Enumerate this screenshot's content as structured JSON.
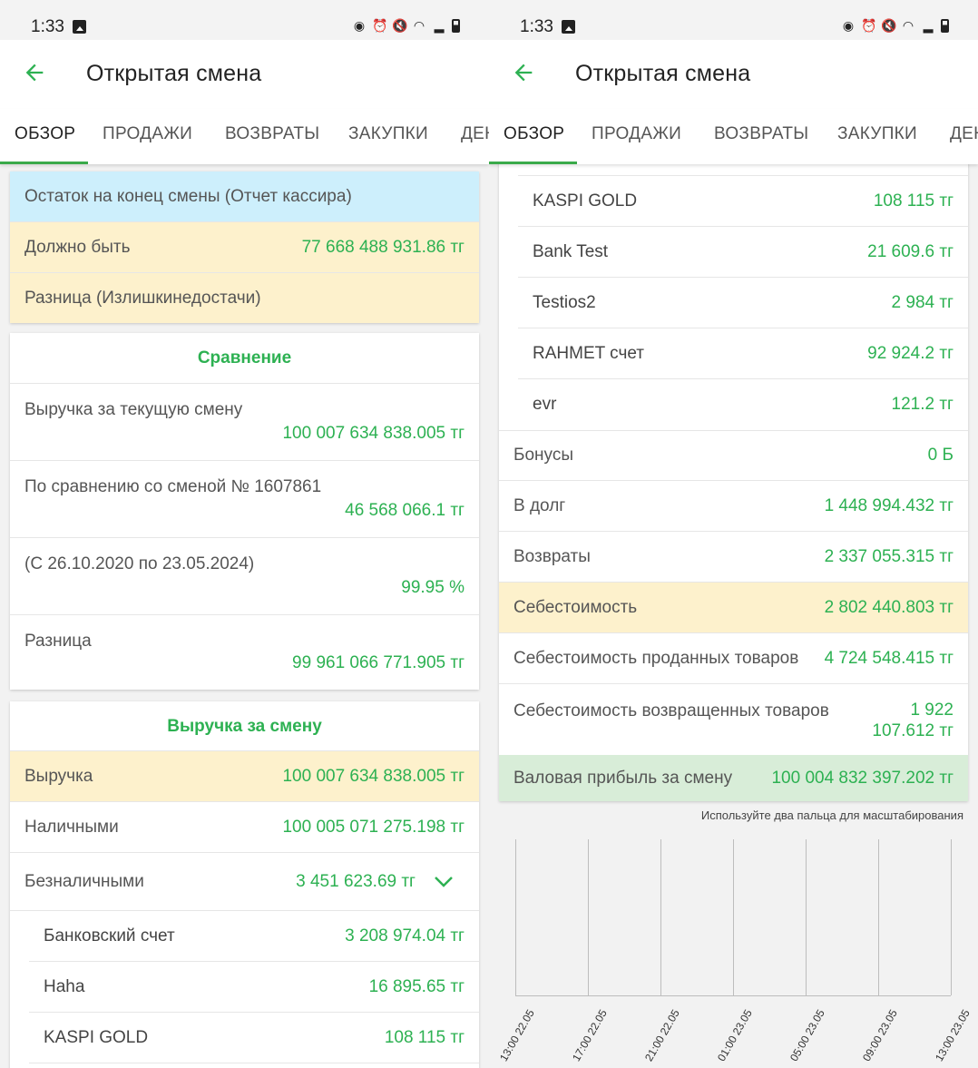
{
  "status": {
    "time": "1:33"
  },
  "appbar": {
    "title": "Открытая смена"
  },
  "tabs": [
    "ОБЗОР",
    "ПРОДАЖИ",
    "ВОЗВРАТЫ",
    "ЗАКУПКИ",
    "ДЕНЬГИ"
  ],
  "left": {
    "balance_card": {
      "title": "Остаток на конец смены (Отчет кассира)",
      "should_be_label": "Должно быть",
      "should_be_value": "77 668 488 931.86 тг",
      "difference_label": "Разница (Излишкинедостачи)"
    },
    "comparison": {
      "title": "Сравнение",
      "rows": [
        {
          "label": "Выручка за текущую смену",
          "value": "100 007 634 838.005 тг"
        },
        {
          "label": "По сравнению со сменой № 1607861",
          "value": "46 568 066.1 тг"
        },
        {
          "label": "(С 26.10.2020 по 23.05.2024)",
          "value": "99.95 %"
        },
        {
          "label": "Разница",
          "value": "99 961 066 771.905 тг"
        }
      ]
    },
    "revenue": {
      "title": "Выручка за смену",
      "total_label": "Выручка",
      "total_value": "100 007 634 838.005 тг",
      "cash_label": "Наличными",
      "cash_value": "100 005 071 275.198 тг",
      "noncash_label": "Безналичными",
      "noncash_value": "3 451 623.69 тг",
      "accounts": [
        {
          "label": "Банковский счет",
          "value": "3 208 974.04 тг"
        },
        {
          "label": "Haha",
          "value": "16 895.65 тг"
        },
        {
          "label": "KASPI GOLD",
          "value": "108 115 тг"
        }
      ]
    }
  },
  "right": {
    "accounts": [
      {
        "label": "KASPI GOLD",
        "value": "108 115 тг"
      },
      {
        "label": "Bank Test",
        "value": "21 609.6 тг"
      },
      {
        "label": "Testios2",
        "value": "2 984 тг"
      },
      {
        "label": "RAHMET счет",
        "value": "92 924.2 тг"
      },
      {
        "label": "evr",
        "value": "121.2 тг"
      }
    ],
    "bonuses": {
      "label": "Бонусы",
      "value": "0 Б"
    },
    "debt": {
      "label": "В долг",
      "value": "1 448 994.432 тг"
    },
    "returns": {
      "label": "Возвраты",
      "value": "2 337 055.315 тг"
    },
    "cost": {
      "label": "Себестоимость",
      "value": "2 802 440.803 тг"
    },
    "cost_sold": {
      "label": "Себестоимость проданных товаров",
      "value": "4 724 548.415 тг"
    },
    "cost_returned": {
      "label": "Себестоимость возвращенных товаров",
      "value_line1": "1 922",
      "value_line2": "107.612 тг"
    },
    "gross_profit": {
      "label": "Валовая прибыль за смену",
      "value": "100 004 832 397.202 тг"
    },
    "zoom_hint": "Используйте два пальца для масштабирования"
  },
  "chart_data": {
    "type": "line",
    "categories": [
      "13:00 22.05",
      "17:00 22.05",
      "21:00 22.05",
      "01:00 23.05",
      "05:00 23.05",
      "09:00 23.05",
      "13:00 23.05"
    ],
    "series": [],
    "grid": true
  },
  "colors": {
    "accent": "#2db152",
    "tab_indicator": "#3aaa4a",
    "highlight_blue": "#cdeffc",
    "highlight_yellow": "#fdf1cc",
    "highlight_green": "#d8edd8"
  }
}
